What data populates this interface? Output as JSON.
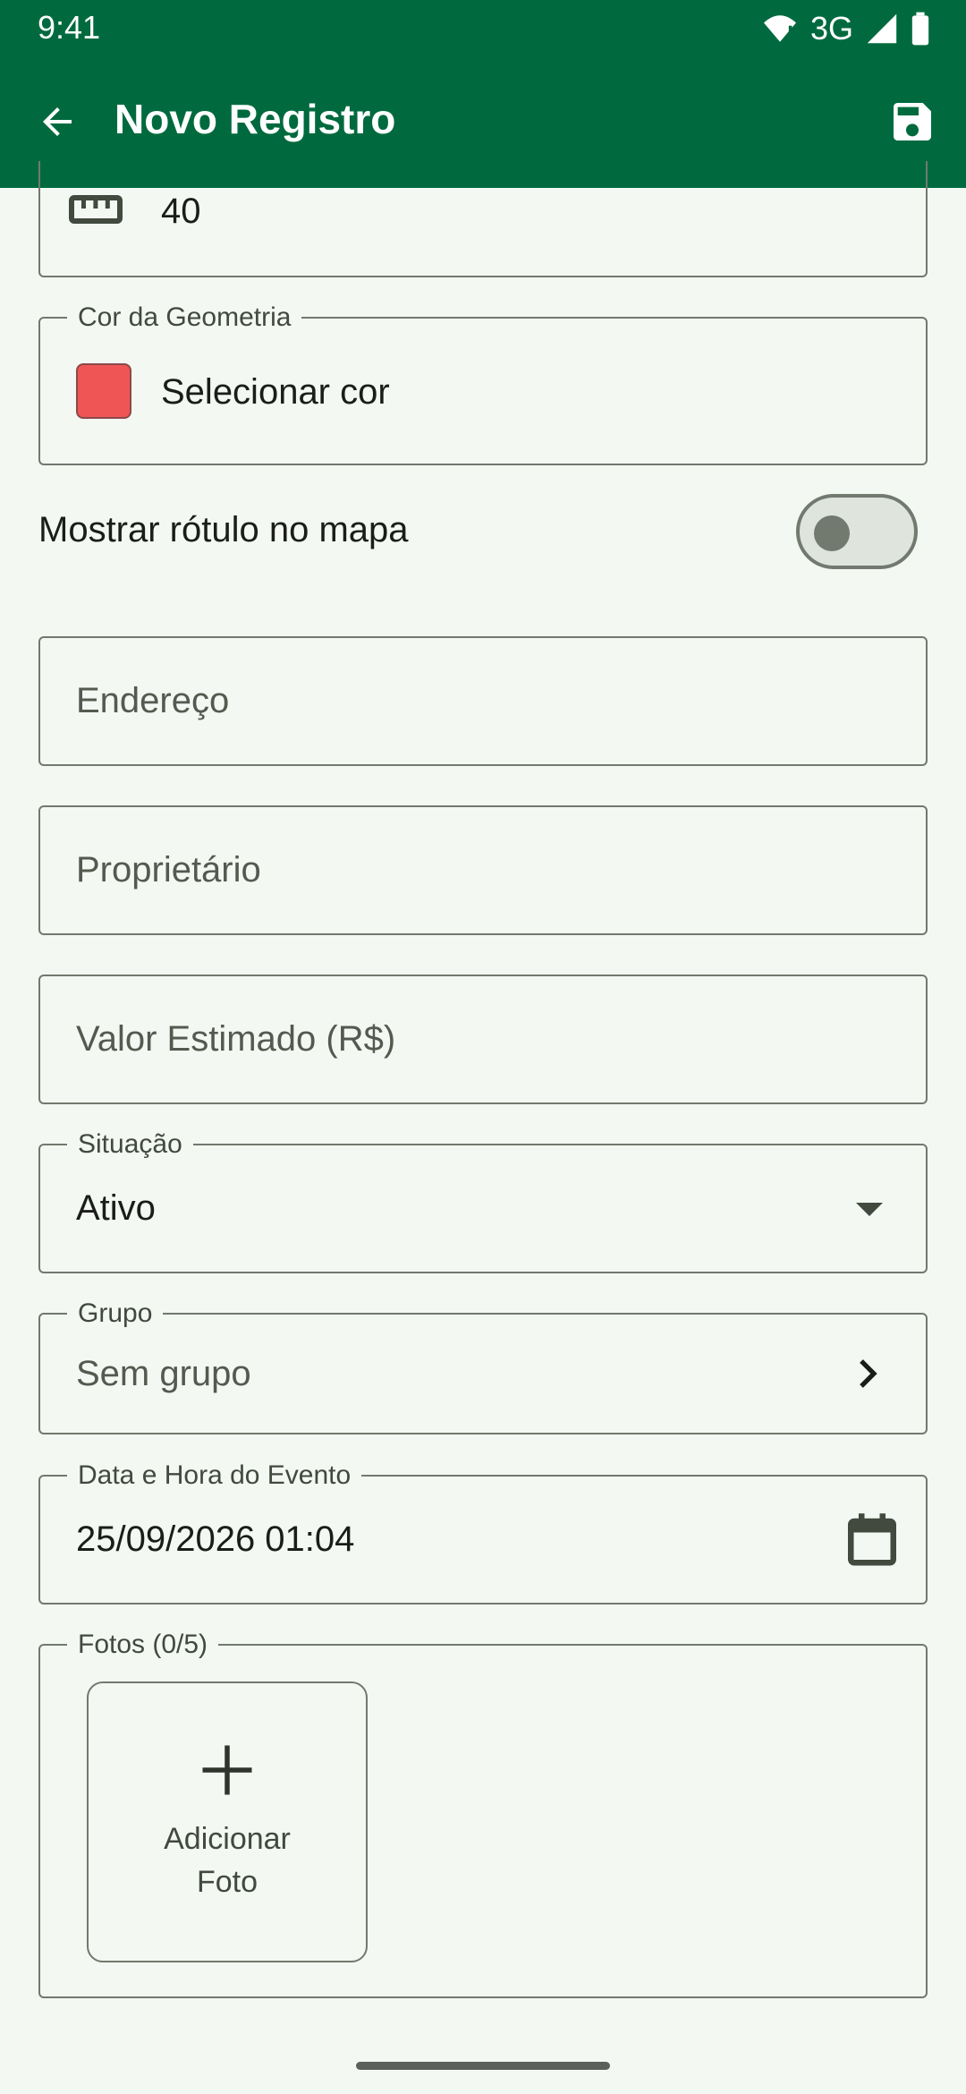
{
  "status_bar": {
    "time": "9:41",
    "network": "3G"
  },
  "app_bar": {
    "title": "Novo Registro",
    "back_icon": "arrow-back-icon",
    "save_icon": "save-icon",
    "background": "#006a3e"
  },
  "form": {
    "measure_field": {
      "icon": "ruler-icon",
      "value": "40"
    },
    "color_field": {
      "legend": "Cor da Geometria",
      "swatch_color": "#f05556",
      "label": "Selecionar cor"
    },
    "show_label_toggle": {
      "label": "Mostrar rótulo no mapa",
      "checked": false
    },
    "address": {
      "placeholder": "Endereço"
    },
    "owner": {
      "placeholder": "Proprietário"
    },
    "estimated_value": {
      "placeholder": "Valor Estimado (R$)"
    },
    "status_select": {
      "legend": "Situação",
      "value": "Ativo"
    },
    "group": {
      "legend": "Grupo",
      "value": "Sem grupo"
    },
    "event_datetime": {
      "legend": "Data e Hora do Evento",
      "value": "25/09/2026 01:04"
    },
    "photos": {
      "legend": "Fotos (0/5)",
      "add_label": "Adicionar Foto"
    }
  }
}
